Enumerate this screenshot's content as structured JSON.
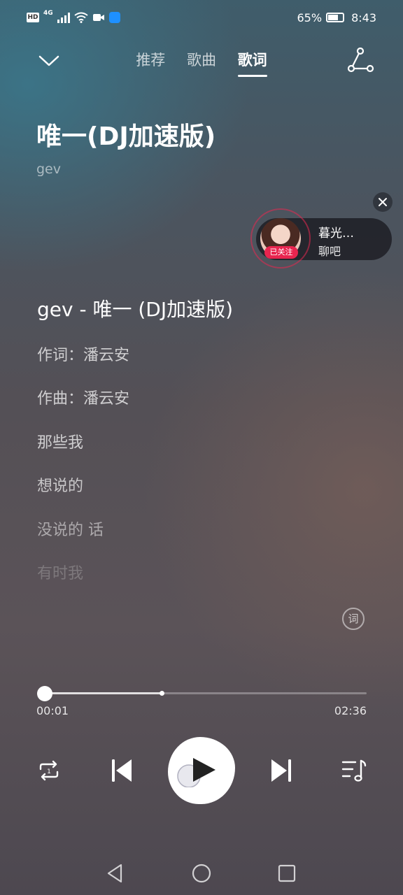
{
  "status_bar": {
    "hd": "HD",
    "network": "4G",
    "battery_percent": "65%",
    "battery_level": 0.65,
    "time": "8:43"
  },
  "header": {
    "tabs": [
      {
        "label": "推荐",
        "active": false
      },
      {
        "label": "歌曲",
        "active": false
      },
      {
        "label": "歌词",
        "active": true
      }
    ]
  },
  "song": {
    "title": "唯一(DJ加速版)",
    "artist": "gev"
  },
  "chat_widget": {
    "name": "暮光…",
    "subtitle": "聊吧",
    "badge": "已关注"
  },
  "lyrics": {
    "lines": [
      "gev - 唯一 (DJ加速版)",
      "作词：潘云安",
      "作曲：潘云安",
      "那些我",
      "想说的",
      "没说的 话",
      "有时我"
    ],
    "word_button": "词"
  },
  "player": {
    "current_time": "00:01",
    "total_time": "02:36",
    "progress": 0.006,
    "buffered": 0.37
  }
}
